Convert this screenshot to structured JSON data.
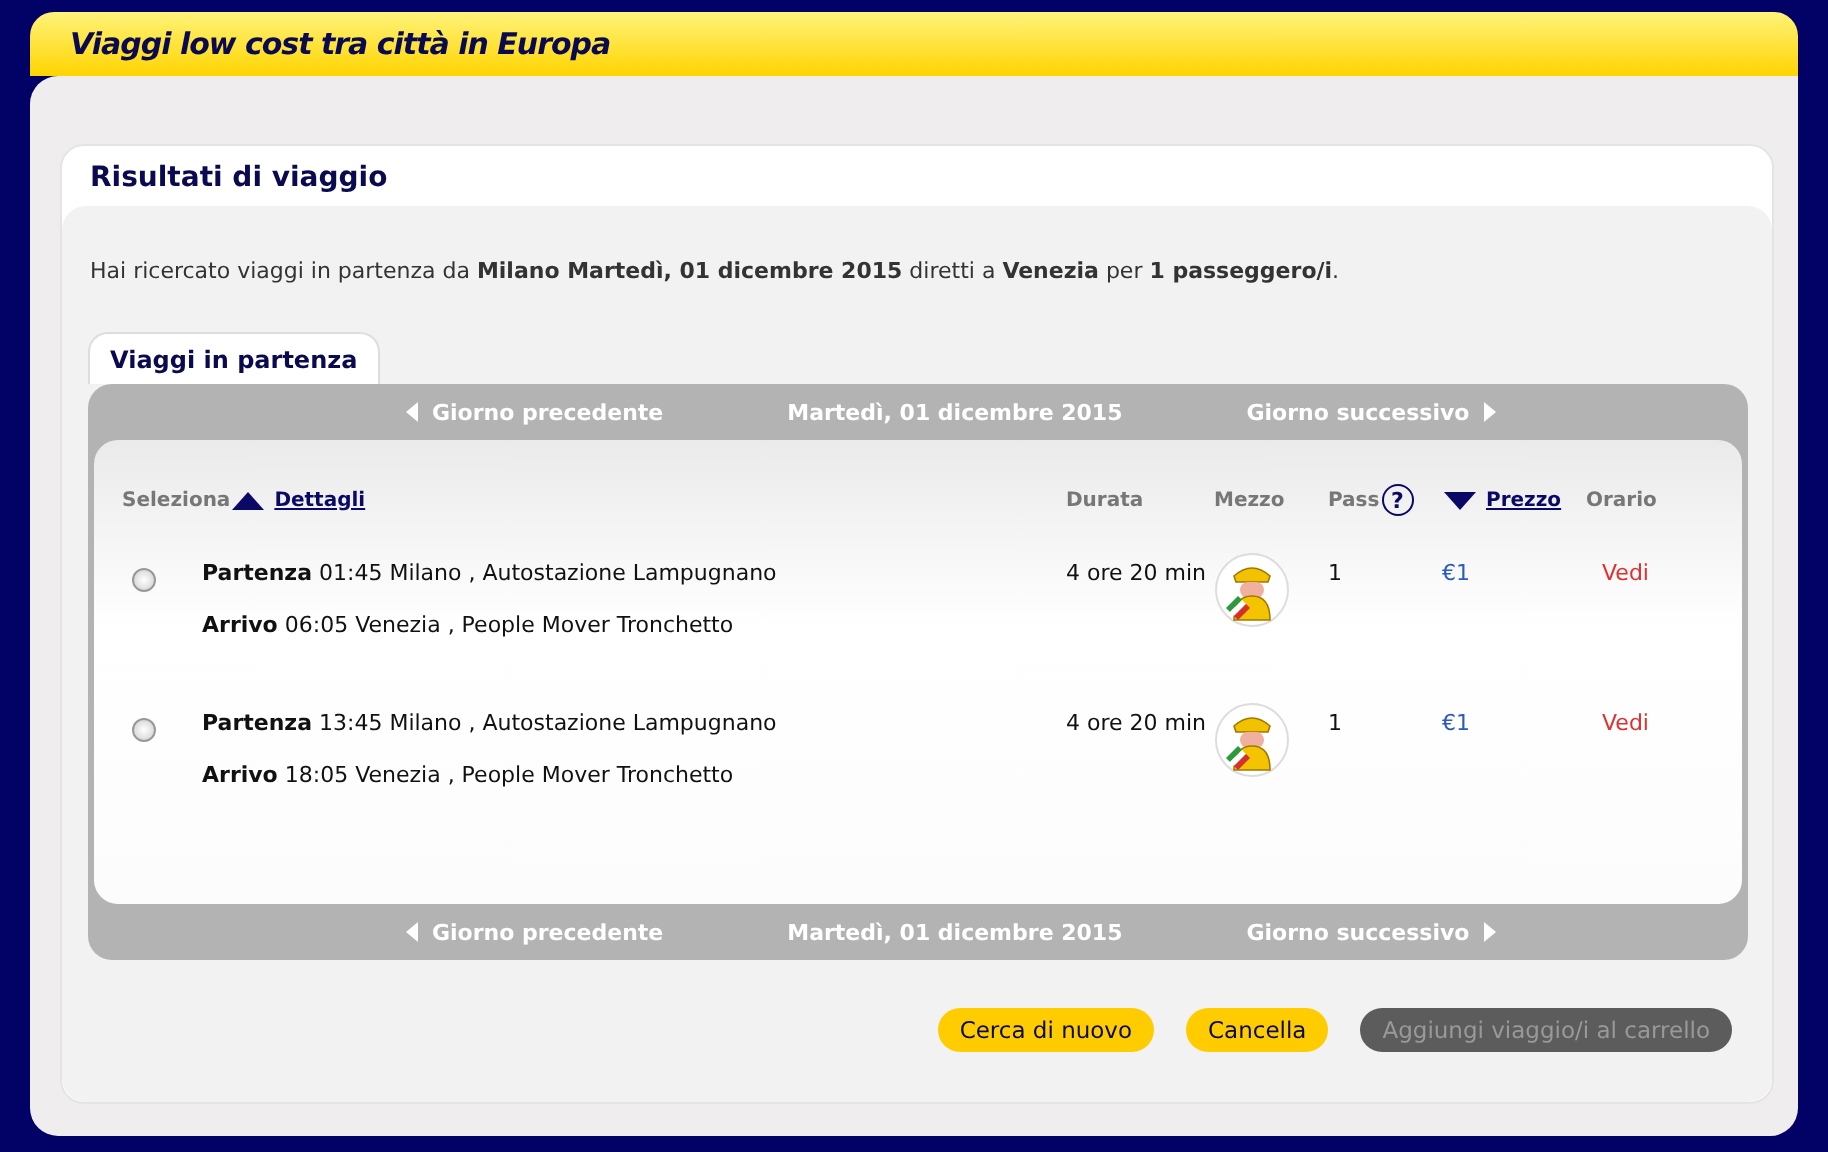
{
  "window": {
    "title": "Viaggi low cost tra città in Europa"
  },
  "card": {
    "title": "Risultati di viaggio",
    "summary": "Hai ricercato viaggi in partenza da **Milano Martedì, 01 dicembre 2015** diretti a **Venezia** per **1 passeggero/i**."
  },
  "tabs": [
    {
      "label": "Viaggi in partenza",
      "selected": true
    }
  ],
  "nav_top": {
    "previous": "Giorno precedente",
    "date": "Martedì, 01 dicembre 2015",
    "next": "Giorno successivo"
  },
  "table": {
    "columns": [
      {
        "kind": "plain",
        "label": "Seleziona"
      },
      {
        "kind": "sort",
        "label": "Dettagli",
        "ascending": true
      },
      {
        "kind": "plain",
        "label": "Durata"
      },
      {
        "kind": "plain",
        "label": "Mezzo"
      },
      {
        "kind": "help",
        "label": "Pass",
        "help": "?"
      },
      {
        "kind": "sort",
        "label": "Prezzo",
        "ascending": false
      },
      {
        "kind": "plain",
        "label": "Orario"
      }
    ],
    "rows": [
      {
        "selected": false,
        "depart_label": "Partenza",
        "depart": "01:45 Milano , Autostazione Lampugnano",
        "arrive_label": "Arrivo",
        "arrive": "06:05 Venezia , People Mover Tronchetto",
        "duration": "4 ore 20 min",
        "pass": "1",
        "price": "€1",
        "schedule": "Vedi"
      },
      {
        "selected": false,
        "depart_label": "Partenza",
        "depart": "13:45 Milano , Autostazione Lampugnano",
        "arrive_label": "Arrivo",
        "arrive": "18:05 Venezia , People Mover Tronchetto",
        "duration": "4 ore 20 min",
        "pass": "1",
        "price": "€1",
        "schedule": "Vedi"
      }
    ]
  },
  "nav_bottom": {
    "previous": "Giorno precedente",
    "date": "Martedì, 01 dicembre 2015",
    "next": "Giorno successivo"
  },
  "buttons": [
    {
      "label": "Cerca di nuovo",
      "disabled": false
    },
    {
      "label": "Cancella",
      "disabled": false
    },
    {
      "label": "Aggiungi viaggio/i al carrello",
      "disabled": true
    }
  ]
}
